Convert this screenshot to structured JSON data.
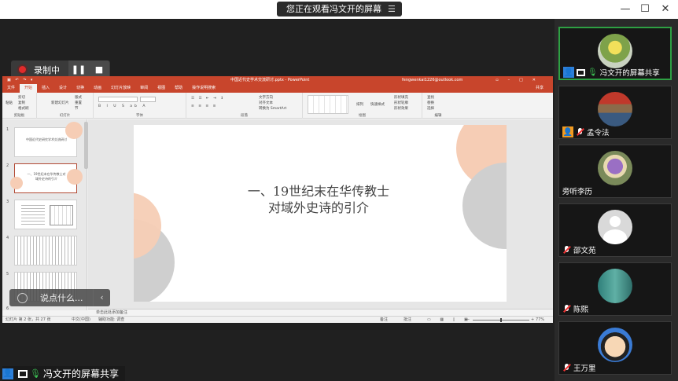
{
  "window": {
    "share_notice": "您正在观看冯文开的屏幕",
    "minimize": "—",
    "maximize": "☐",
    "close": "✕"
  },
  "recording": {
    "label": "录制中",
    "pause_icon": "pause-icon",
    "stop_icon": "stop-icon"
  },
  "ppt": {
    "doc_title": "中国近代史学术交流研讨.pptx - PowerPoint",
    "account": "fengwenkai1226@outlook.com",
    "tabs": [
      "文件",
      "开始",
      "插入",
      "设计",
      "切换",
      "动画",
      "幻灯片放映",
      "审阅",
      "视图",
      "帮助",
      "操作说明搜索"
    ],
    "active_tab": "开始",
    "share_label": "共享",
    "groups": [
      "剪贴板",
      "幻灯片",
      "字体",
      "段落",
      "绘图",
      "编辑"
    ],
    "ribbon_items": {
      "paste": "粘贴",
      "cut": "剪切",
      "copy": "复制",
      "format_painter": "格式刷",
      "new_slide": "新建幻灯片",
      "layout": "版式",
      "reset": "重置",
      "section": "节",
      "text_direction": "文字方向",
      "align_text": "对齐文本",
      "smartart": "转换为 SmartArt",
      "arrange": "排列",
      "quick_styles": "快速样式",
      "fill": "形状填充",
      "outline": "形状轮廓",
      "effects": "形状效果",
      "find": "查找",
      "replace": "替换",
      "select": "选择"
    },
    "thumb_numbers": [
      "1",
      "2",
      "3",
      "4",
      "5",
      "6"
    ],
    "thumb1_text": "中国近代史研究学术交流研讨",
    "thumb2_text": "一、19世纪末在华传教士对域外史诗的引介",
    "slide_title_line1": "一、19世纪末在华传教士",
    "slide_title_line2": "对域外史诗的引介",
    "notes_placeholder": "单击此处添加备注",
    "status_slide": "幻灯片 第 2 张，共 27 张",
    "status_lang": "中文(中国)",
    "status_access": "辅助功能: 调查",
    "status_notes": "备注",
    "status_comments": "批注",
    "zoom": "77%"
  },
  "chat": {
    "placeholder": "说点什么...",
    "collapse": "‹"
  },
  "presenter_bar": {
    "name": "冯文开的屏幕共享"
  },
  "participants": [
    {
      "name": "冯文开的屏幕共享",
      "role": "host",
      "mic": "on",
      "sharing": true
    },
    {
      "name": "孟令法",
      "role": "cohost",
      "mic": "off",
      "sharing": false
    },
    {
      "name": "旁听李历",
      "role": "none",
      "mic": "none",
      "sharing": false
    },
    {
      "name": "邵文苑",
      "role": "none",
      "mic": "off",
      "sharing": false
    },
    {
      "name": "陈熙",
      "role": "none",
      "mic": "off",
      "sharing": false
    },
    {
      "name": "王万里",
      "role": "none",
      "mic": "off",
      "sharing": false
    }
  ],
  "colors": {
    "ppt_accent": "#c8452c",
    "active_speaker": "#2ea043",
    "host_badge": "#2d7fd8",
    "cohost_badge": "#f29b21",
    "recording": "#e02b2b"
  }
}
